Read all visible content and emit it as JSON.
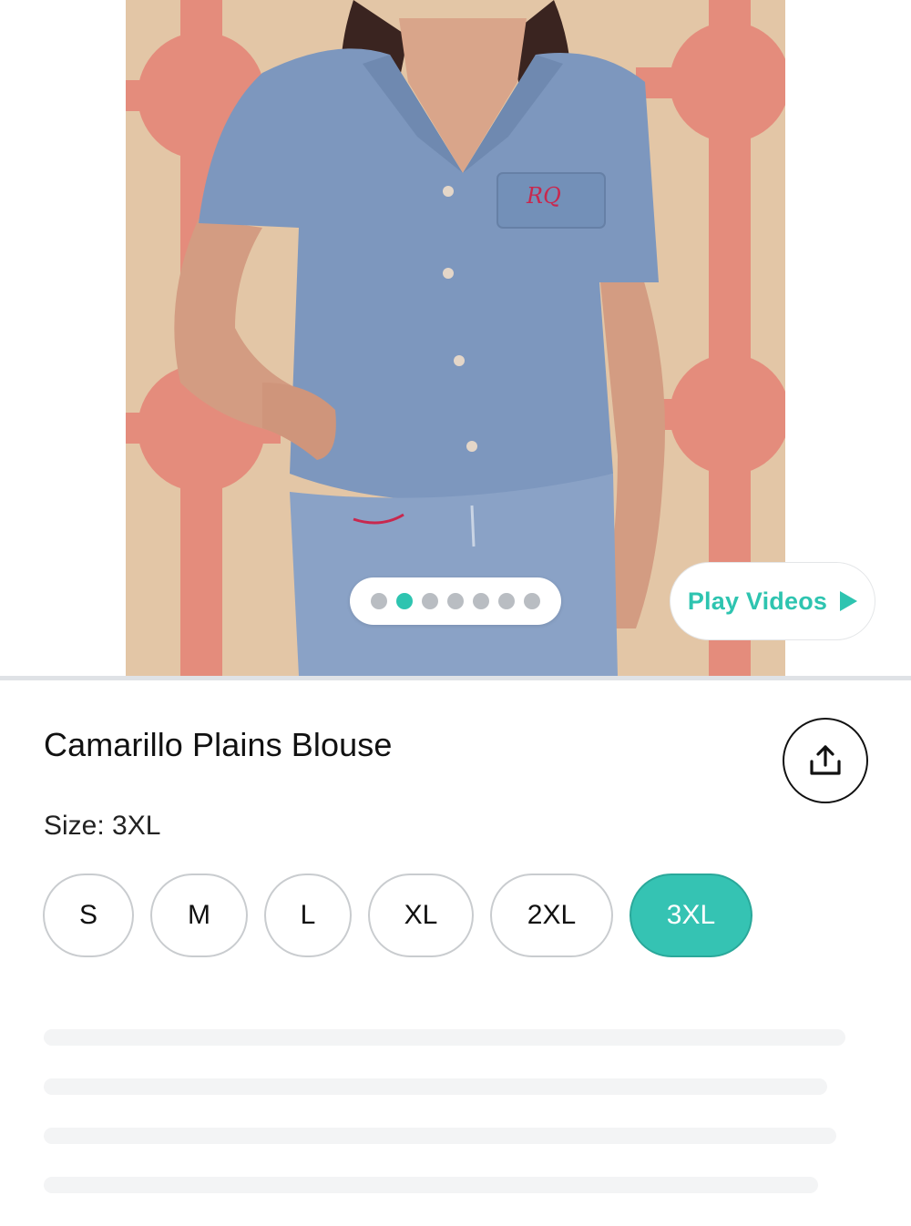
{
  "gallery": {
    "image_alt": "Woman wearing a chambray short-sleeve blouse with embroidered RQ pocket",
    "pocket_monogram": "RQ",
    "slide_count": 7,
    "active_slide": 2
  },
  "play_videos": {
    "label": "Play Videos",
    "icon": "play-icon",
    "color": "#2ec4b0"
  },
  "product": {
    "title": "Camarillo Plains Blouse",
    "share_icon": "share-upload-icon"
  },
  "size": {
    "label": "Size:",
    "selected": "3XL",
    "options": [
      "S",
      "M",
      "L",
      "XL",
      "2XL",
      "3XL"
    ],
    "accent": "#35c3b3"
  }
}
